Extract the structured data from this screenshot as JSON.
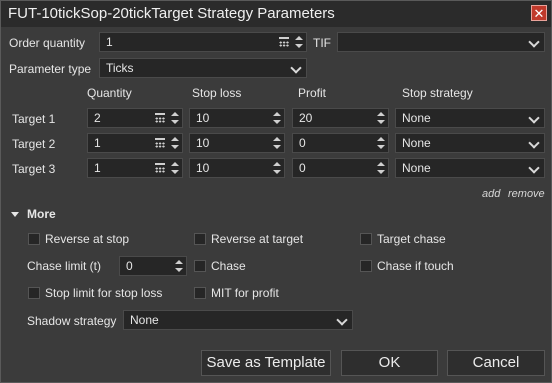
{
  "window": {
    "title": "FUT-10tickSop-20tickTarget Strategy Parameters"
  },
  "order": {
    "quantity_label": "Order quantity",
    "quantity_value": "1",
    "tif_label": "TIF",
    "tif_value": "",
    "parameter_type_label": "Parameter type",
    "parameter_type_value": "Ticks"
  },
  "targets": {
    "headers": {
      "quantity": "Quantity",
      "stop_loss": "Stop loss",
      "profit": "Profit",
      "stop_strategy": "Stop strategy"
    },
    "rows": [
      {
        "label": "Target 1",
        "quantity": "2",
        "stop_loss": "10",
        "profit": "20",
        "stop_strategy": "None"
      },
      {
        "label": "Target 2",
        "quantity": "1",
        "stop_loss": "10",
        "profit": "0",
        "stop_strategy": "None"
      },
      {
        "label": "Target 3",
        "quantity": "1",
        "stop_loss": "10",
        "profit": "0",
        "stop_strategy": "None"
      }
    ],
    "add_label": "add",
    "remove_label": "remove"
  },
  "more": {
    "label": "More",
    "reverse_at_stop": "Reverse at stop",
    "reverse_at_target": "Reverse at target",
    "target_chase": "Target chase",
    "chase_limit_label": "Chase limit (t)",
    "chase_limit_value": "0",
    "chase": "Chase",
    "chase_if_touch": "Chase if touch",
    "stop_limit": "Stop limit for stop loss",
    "mit_for_profit": "MIT for profit",
    "shadow_strategy_label": "Shadow strategy",
    "shadow_strategy_value": "None"
  },
  "buttons": {
    "save_template": "Save as Template",
    "ok": "OK",
    "cancel": "Cancel"
  }
}
